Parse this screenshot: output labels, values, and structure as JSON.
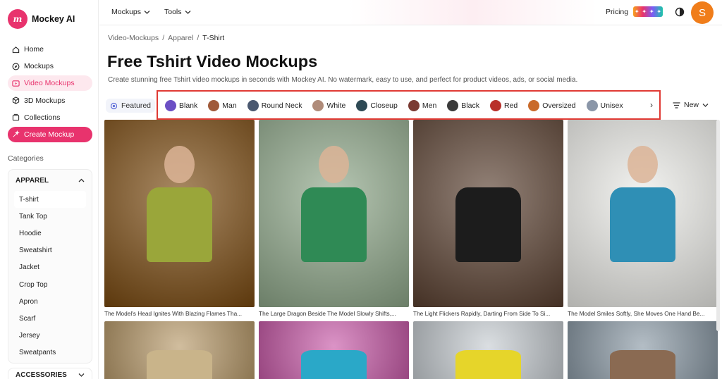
{
  "app": {
    "name": "Mockey AI",
    "logo_glyph": "m"
  },
  "sidebar": {
    "nav": [
      {
        "label": "Home",
        "icon": "home-icon"
      },
      {
        "label": "Mockups",
        "icon": "compass-icon"
      },
      {
        "label": "Video Mockups",
        "icon": "play-icon",
        "active": true
      },
      {
        "label": "3D Mockups",
        "icon": "cube-icon"
      },
      {
        "label": "Collections",
        "icon": "collection-icon"
      },
      {
        "label": "Create Mockup",
        "icon": "magic-icon"
      }
    ],
    "categories_label": "Categories",
    "apparel": {
      "title": "APPAREL",
      "items": [
        "T-shirt",
        "Tank Top",
        "Hoodie",
        "Sweatshirt",
        "Jacket",
        "Crop Top",
        "Apron",
        "Scarf",
        "Jersey",
        "Sweatpants"
      ],
      "active_item": "T-shirt"
    },
    "accessories_title": "ACCESSORIES"
  },
  "topbar": {
    "menus": [
      "Mockups",
      "Tools"
    ],
    "pricing": "Pricing",
    "avatar_letter": "S"
  },
  "breadcrumb": [
    "Video-Mockups",
    "Apparel",
    "T-Shirt"
  ],
  "page": {
    "title": "Free Tshirt Video Mockups",
    "description": "Create stunning free Tshirt video mockups in seconds with Mockey AI. No watermark, easy to use, and perfect for product videos, ads, or social media."
  },
  "filters": {
    "featured": "Featured",
    "chips": [
      "Blank",
      "Man",
      "Round Neck",
      "White",
      "Closeup",
      "Men",
      "Black",
      "Red",
      "Oversized",
      "Unisex"
    ],
    "chip_colors": [
      "#6b4fc4",
      "#a05a3a",
      "#4a5870",
      "#b08c7a",
      "#2e4a55",
      "#7a3a32",
      "#3a3a3a",
      "#b8302a",
      "#c96a2a",
      "#8a96a8"
    ],
    "sort_label": "New"
  },
  "cards": [
    {
      "caption": "The Model's Head Ignites With Blazing Flames Tha...",
      "bg": "#7a4a10"
    },
    {
      "caption": "The Large Dragon Beside The Model Slowly Shifts,...",
      "bg": "#8fa88a"
    },
    {
      "caption": "The Light Flickers Rapidly, Darting From Side To Si...",
      "bg": "#5a4030"
    },
    {
      "caption": "The Model Smiles Softly, She Moves One Hand Be...",
      "bg": "#ecece8"
    },
    {
      "caption": "",
      "bg": "#b89a6a"
    },
    {
      "caption": "",
      "bg": "#c85aa8"
    },
    {
      "caption": "",
      "bg": "#c7cdd2"
    },
    {
      "caption": "",
      "bg": "#8b9aa6"
    }
  ]
}
